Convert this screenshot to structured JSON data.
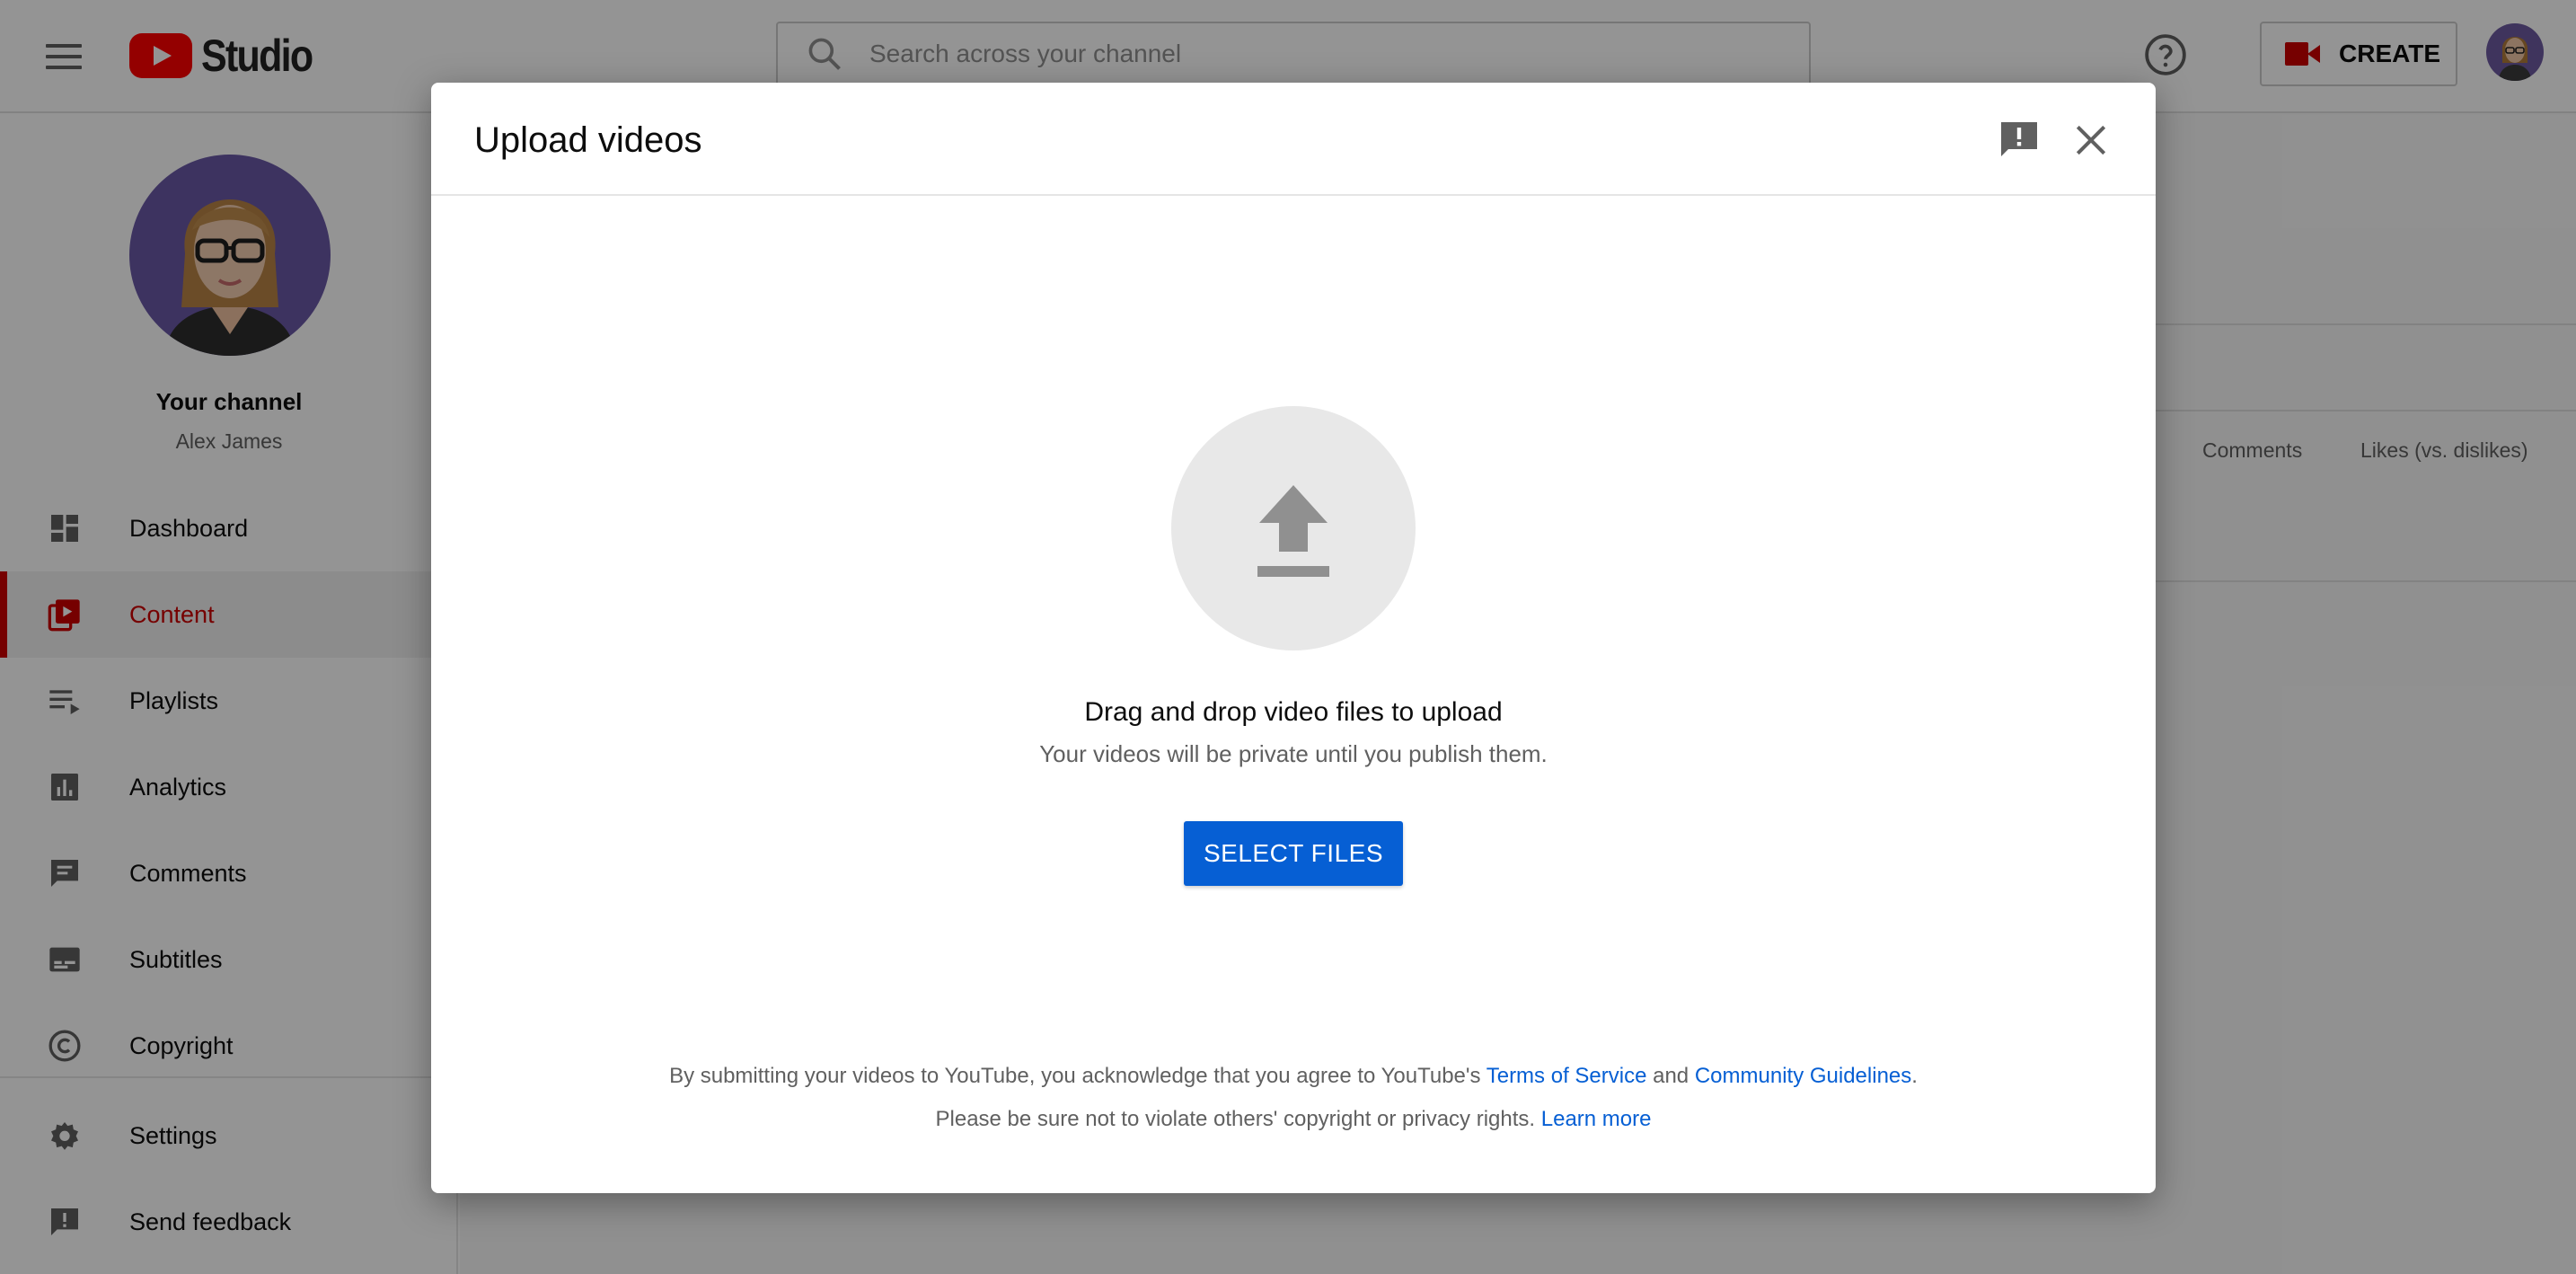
{
  "app": {
    "logo_text": "Studio",
    "search_placeholder": "Search across your channel",
    "create_label": "CREATE"
  },
  "channel": {
    "title": "Your channel",
    "name": "Alex James"
  },
  "sidebar": {
    "items": [
      {
        "label": "Dashboard",
        "icon": "dashboard-icon"
      },
      {
        "label": "Content",
        "icon": "content-icon",
        "active": true
      },
      {
        "label": "Playlists",
        "icon": "playlists-icon"
      },
      {
        "label": "Analytics",
        "icon": "analytics-icon"
      },
      {
        "label": "Comments",
        "icon": "comments-icon"
      },
      {
        "label": "Subtitles",
        "icon": "subtitles-icon"
      },
      {
        "label": "Copyright",
        "icon": "copyright-icon"
      }
    ],
    "bottom_items": [
      {
        "label": "Settings",
        "icon": "settings-icon"
      },
      {
        "label": "Send feedback",
        "icon": "feedback-icon"
      }
    ]
  },
  "table": {
    "columns": [
      "Comments",
      "Likes (vs. dislikes)"
    ]
  },
  "dialog": {
    "title": "Upload videos",
    "drop_title": "Drag and drop video files to upload",
    "drop_subtitle": "Your videos will be private until you publish them.",
    "select_button": "SELECT FILES",
    "legal_line1_prefix": "By submitting your videos to YouTube, you acknowledge that you agree to YouTube's ",
    "terms_link": "Terms of Service",
    "legal_and": " and ",
    "guidelines_link": "Community Guidelines",
    "legal_period": ".",
    "legal_line2_prefix": "Please be sure not to violate others' copyright or privacy rights. ",
    "learn_more_link": "Learn more"
  },
  "colors": {
    "accent": "#065fd4",
    "brand_red": "#cc0000"
  }
}
